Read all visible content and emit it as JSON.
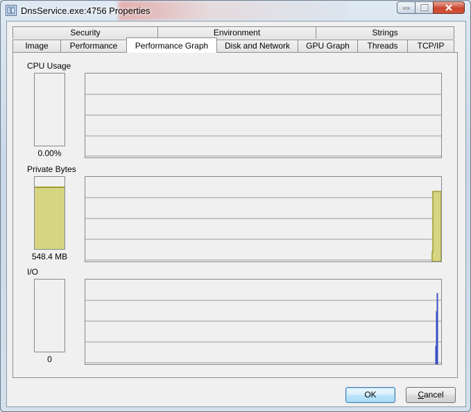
{
  "window": {
    "title": "DnsService.exe:4756 Properties",
    "app_icon": "process-explorer-icon",
    "caption_buttons": {
      "minimize": "minimize-icon",
      "maximize": "maximize-icon",
      "close": "close-icon"
    }
  },
  "tabs": {
    "row1": [
      {
        "label": "Security"
      },
      {
        "label": "Environment"
      },
      {
        "label": "Strings"
      }
    ],
    "row2": [
      {
        "label": "Image"
      },
      {
        "label": "Performance"
      },
      {
        "label": "Performance Graph",
        "active": true
      },
      {
        "label": "Disk and Network"
      },
      {
        "label": "GPU Graph"
      },
      {
        "label": "Threads"
      },
      {
        "label": "TCP/IP"
      }
    ]
  },
  "sections": {
    "cpu": {
      "label": "CPU Usage",
      "value": "0.00%",
      "fill": 0.0
    },
    "private_bytes": {
      "label": "Private Bytes",
      "value": "548.4 MB",
      "fill": 0.85,
      "color": "#d6d582"
    },
    "io": {
      "label": "I/O",
      "value": "0",
      "fill": 0.0,
      "color": "#3a4fc4"
    }
  },
  "buttons": {
    "ok": "OK",
    "cancel_prefix": "C",
    "cancel_rest": "ancel"
  }
}
